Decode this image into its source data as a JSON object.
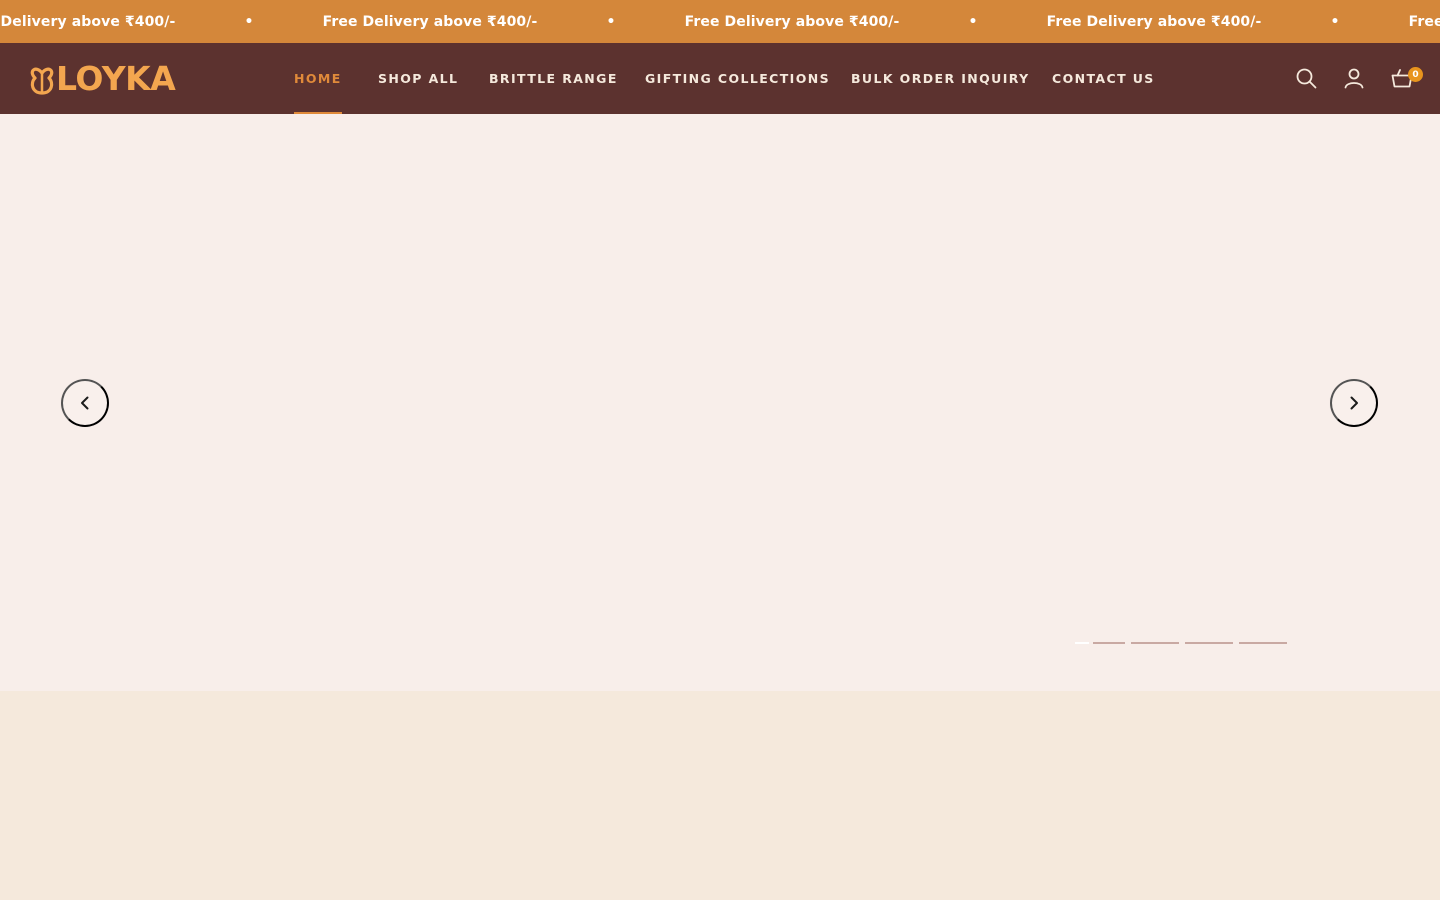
{
  "announcement": {
    "messages": [
      "Free Delivery above ₹400/-",
      "Free Delivery above ₹400/-",
      "Free Delivery above ₹400/-",
      "Free Delivery above ₹400/-",
      "Free Delivery above ₹400/-"
    ],
    "separator": "•",
    "background_color": "#d4873a"
  },
  "header": {
    "logo_text": "LOYKA",
    "logo_color": "#f3a64f",
    "background_color": "#5c322f",
    "nav": [
      {
        "label": "HOME",
        "active": true
      },
      {
        "label": "SHOP ALL",
        "active": false
      },
      {
        "label": "BRITTLE RANGE",
        "active": false
      },
      {
        "label": "GIFTING COLLECTIONS",
        "active": false
      },
      {
        "label": "BULK ORDER INQUIRY",
        "active": false
      },
      {
        "label": "CONTACT US",
        "active": false
      }
    ],
    "icons": [
      "search-icon",
      "account-icon",
      "cart-icon"
    ],
    "cart_count": "0",
    "accent_color": "#e08a3a"
  },
  "hero": {
    "background_color": "#f8eeea",
    "prev_icon": "chevron-left-icon",
    "next_icon": "chevron-right-icon",
    "slide_count": 5,
    "active_slide": 0
  }
}
